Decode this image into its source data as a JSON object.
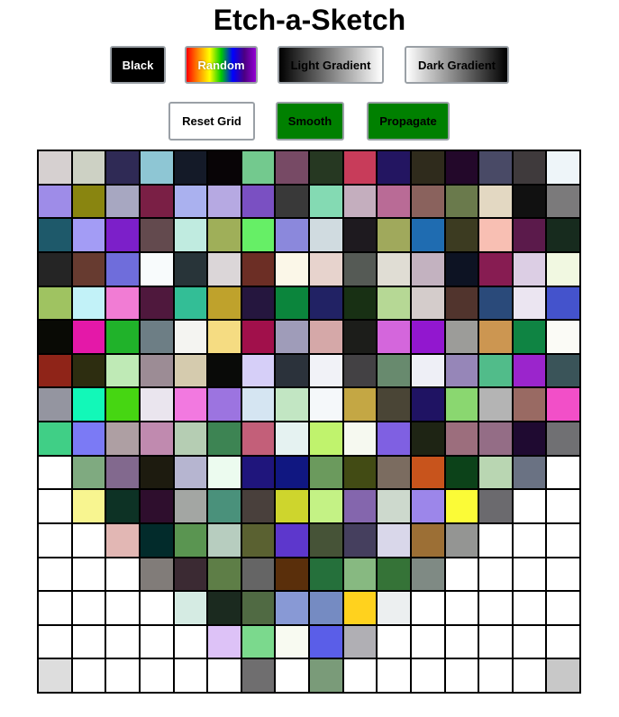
{
  "title": "Etch-a-Sketch",
  "buttons_row1": [
    {
      "id": "btn-black",
      "name": "black-button",
      "label": "Black",
      "bg": "linear-gradient(#000000,#000000)",
      "color": "#ffffff"
    },
    {
      "id": "btn-random",
      "name": "random-button",
      "label": "Random",
      "bg": "linear-gradient(to right,#ff0000,#ff8800,#ffff00,#00cc00,#0000ff,#4b0082,#9400d3)",
      "color": "#ffffff"
    },
    {
      "id": "btn-light",
      "name": "light-gradient-button",
      "label": "Light Gradient",
      "bg": "linear-gradient(to right,#000000,#ffffff)",
      "color": "#000000"
    },
    {
      "id": "btn-dark",
      "name": "dark-gradient-button",
      "label": "Dark Gradient",
      "bg": "linear-gradient(to right,#ffffff,#000000)",
      "color": "#000000"
    }
  ],
  "buttons_row2": [
    {
      "id": "btn-reset",
      "name": "reset-grid-button",
      "label": "Reset Grid",
      "bg": "linear-gradient(#ffffff,#ffffff)",
      "color": "#000000"
    },
    {
      "id": "btn-smooth",
      "name": "smooth-button",
      "label": "Smooth",
      "bg": "linear-gradient(#008000,#008000)",
      "color": "#000000"
    },
    {
      "id": "btn-propagate",
      "name": "propagate-button",
      "label": "Propagate",
      "bg": "linear-gradient(#008000,#008000)",
      "color": "#000000"
    }
  ],
  "grid": {
    "size": 16,
    "cells": [
      [
        "#d6d0d0",
        "#cdd1c4",
        "#2f2a55",
        "#8ec6d4",
        "#141a28",
        "#080406",
        "#73c98e",
        "#774a65",
        "#263822",
        "#c83c5a",
        "#231561",
        "#2f2b1c",
        "#23082a",
        "#494a66",
        "#3f3a3c",
        "#eef5f9"
      ],
      [
        "#9e8ce8",
        "#898510",
        "#a7a7c1",
        "#7a1f45",
        "#aab1ef",
        "#b6a9e2",
        "#7a50c2",
        "#393939",
        "#84dab3",
        "#c4aebe",
        "#b96b96",
        "#8a625d",
        "#6a7a4c",
        "#e3d8c2",
        "#111111",
        "#7b7a7b"
      ],
      [
        "#1e596a",
        "#a39cf5",
        "#7c1fc9",
        "#634a4e",
        "#c0ebe0",
        "#9faf59",
        "#66ef66",
        "#8b88dc",
        "#d0dbe0",
        "#1e1a1f",
        "#a0a95c",
        "#1f6cb1",
        "#3c3b21",
        "#f8bfb3",
        "#5b1a4b",
        "#172b1e"
      ],
      [
        "#252525",
        "#673b30",
        "#6f6ddb",
        "#f8fbfc",
        "#283439",
        "#dbd6d8",
        "#6c2e25",
        "#fbf7e8",
        "#e7d3cd",
        "#555a55",
        "#e0ddd4",
        "#c3b2c0",
        "#0d1323",
        "#871c52",
        "#dccee4",
        "#f1f8e1"
      ],
      [
        "#9fc361",
        "#c2f2f8",
        "#f17cd4",
        "#4f183d",
        "#33be96",
        "#bfa22c",
        "#25163e",
        "#0b853c",
        "#212264",
        "#183014",
        "#b6d895",
        "#d4cccb",
        "#51342d",
        "#2a4a7a",
        "#ebe5f1",
        "#4453cc"
      ],
      [
        "#090a05",
        "#e418a8",
        "#20b22a",
        "#6d7e85",
        "#f4f4f1",
        "#f5dc82",
        "#a1104b",
        "#9f9cb9",
        "#d5a8a8",
        "#1c1d1a",
        "#d466dc",
        "#9217cf",
        "#9c9c99",
        "#cc9651",
        "#0f8443",
        "#fbfbf6"
      ],
      [
        "#8f2418",
        "#2d2d10",
        "#bfeab6",
        "#9c8c95",
        "#d5cbae",
        "#090a08",
        "#d6cff8",
        "#2b323b",
        "#f1f2f7",
        "#434144",
        "#688a6e",
        "#eeeff6",
        "#9686b8",
        "#51bc8a",
        "#9b25cc",
        "#3a5459"
      ],
      [
        "#9495a0",
        "#12f8b8",
        "#46d612",
        "#eae5ee",
        "#f279e0",
        "#9c74e0",
        "#d5e5f2",
        "#c2e6c3",
        "#f5f8fa",
        "#c4a744",
        "#4a4536",
        "#1f1363",
        "#8ad770",
        "#b4b4b4",
        "#996a63",
        "#f24fc8"
      ],
      [
        "#40cf86",
        "#7b7af5",
        "#ae9fa3",
        "#c08aaf",
        "#b5cdb3",
        "#3d8453",
        "#c35f79",
        "#e5f2f1",
        "#c0f36d",
        "#f6f9f0",
        "#7f60e2",
        "#1e2414",
        "#9c6e7d",
        "#946d86",
        "#1f0a31",
        "#707073"
      ],
      [
        "#ffffff",
        "#7faa80",
        "#82698e",
        "#1d1b0f",
        "#b6b5d0",
        "#ecfbef",
        "#1f157c",
        "#101781",
        "#6b9a5d",
        "#424b14",
        "#7b6c60",
        "#c8541c",
        "#0c4219",
        "#b9d6b2",
        "#6a7283",
        "#ffffff"
      ],
      [
        "#ffffff",
        "#f8f590",
        "#0d3225",
        "#2e0e2d",
        "#a3a6a3",
        "#4a917b",
        "#49403c",
        "#ced52d",
        "#c4f285",
        "#8466ad",
        "#cdd9cd",
        "#9c86ea",
        "#fbfb37",
        "#6b6a6e",
        "#ffffff",
        "#ffffff"
      ],
      [
        "#ffffff",
        "#ffffff",
        "#e2b7b4",
        "#022b2b",
        "#5a9551",
        "#b7cdbf",
        "#5a6131",
        "#5d37cc",
        "#465337",
        "#453f5e",
        "#d9d7ea",
        "#9c6f35",
        "#949593",
        "#ffffff",
        "#ffffff",
        "#ffffff"
      ],
      [
        "#ffffff",
        "#ffffff",
        "#ffffff",
        "#817c79",
        "#3b2a33",
        "#5e7e47",
        "#656565",
        "#5a2f0b",
        "#25703b",
        "#87b981",
        "#357337",
        "#7f8a84",
        "#ffffff",
        "#ffffff",
        "#ffffff",
        "#ffffff"
      ],
      [
        "#ffffff",
        "#ffffff",
        "#ffffff",
        "#ffffff",
        "#d5ebe3",
        "#1b2a1f",
        "#506a43",
        "#8899d5",
        "#758bc2",
        "#ffd21e",
        "#eceff0",
        "#ffffff",
        "#ffffff",
        "#ffffff",
        "#ffffff",
        "#ffffff"
      ],
      [
        "#ffffff",
        "#ffffff",
        "#ffffff",
        "#ffffff",
        "#ffffff",
        "#ddc2f7",
        "#7bd98d",
        "#f8faf1",
        "#5a5ee8",
        "#b0afb4",
        "#ffffff",
        "#ffffff",
        "#ffffff",
        "#ffffff",
        "#ffffff",
        "#ffffff"
      ],
      [
        "#dddddd",
        "#ffffff",
        "#ffffff",
        "#ffffff",
        "#ffffff",
        "#ffffff",
        "#6f6e6f",
        "#ffffff",
        "#7a9b79",
        "#ffffff",
        "#ffffff",
        "#ffffff",
        "#ffffff",
        "#ffffff",
        "#ffffff",
        "#c8c8c8"
      ]
    ]
  }
}
